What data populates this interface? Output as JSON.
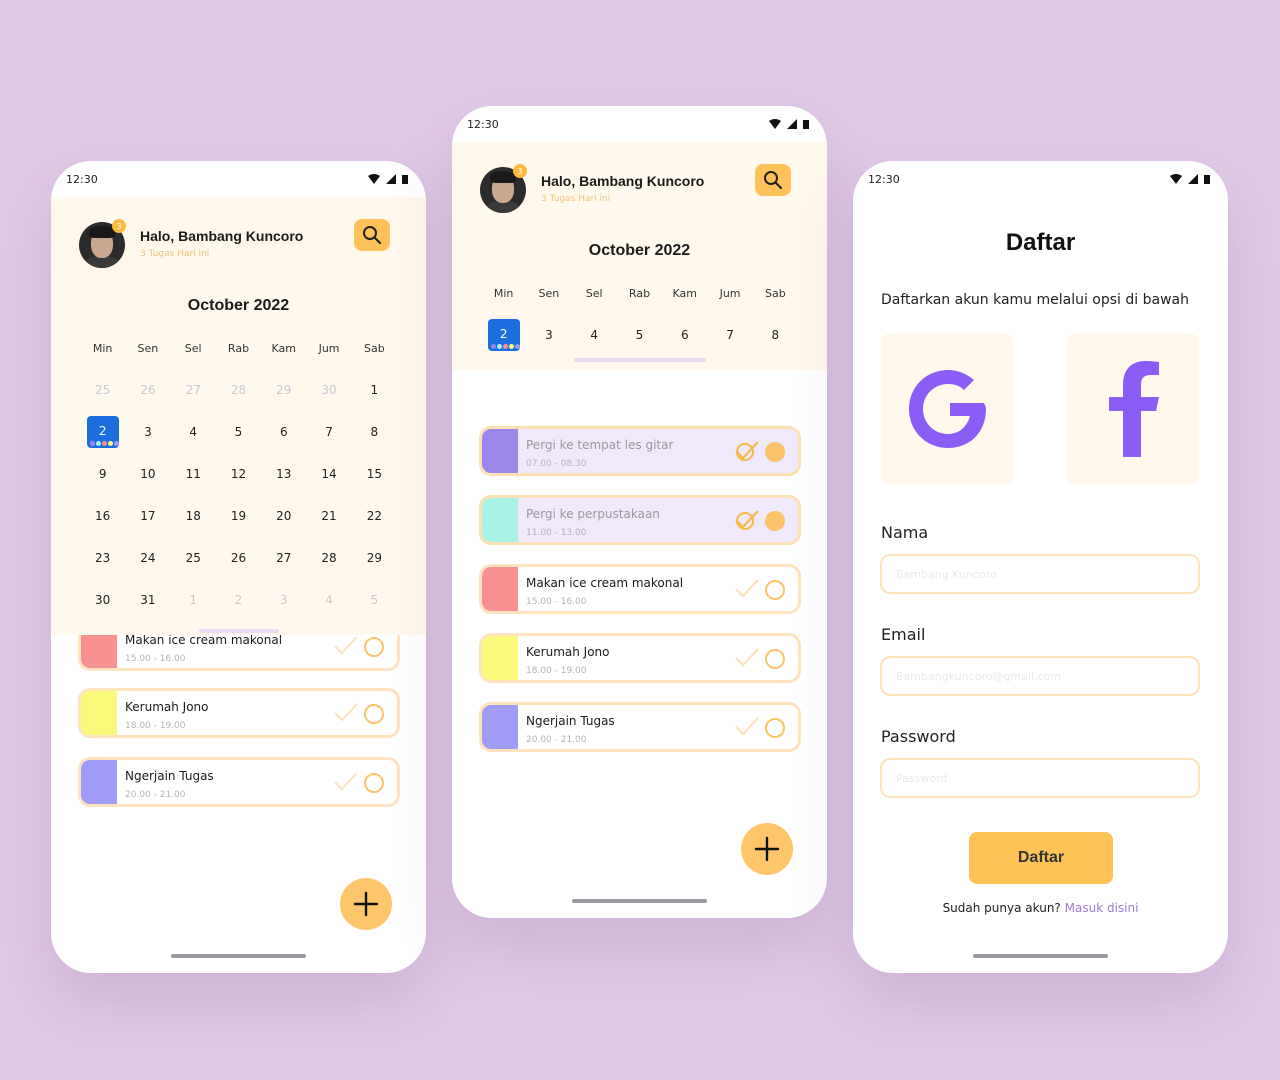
{
  "status": {
    "time": "12:30"
  },
  "user": {
    "greeting": "Halo, Bambang Kuncoro",
    "subtitle": "3 Tugas Hari ini",
    "badge": "3"
  },
  "calendar": {
    "month": "October 2022",
    "weekdays": [
      "Min",
      "Sen",
      "Sel",
      "Rab",
      "Kam",
      "Jum",
      "Sab"
    ],
    "selected_day": "2",
    "month_weeks": [
      [
        "25",
        "26",
        "27",
        "28",
        "29",
        "30",
        "1"
      ],
      [
        "2",
        "3",
        "4",
        "5",
        "6",
        "7",
        "8"
      ],
      [
        "9",
        "10",
        "11",
        "12",
        "13",
        "14",
        "15"
      ],
      [
        "16",
        "17",
        "18",
        "19",
        "20",
        "21",
        "22"
      ],
      [
        "23",
        "24",
        "25",
        "26",
        "27",
        "28",
        "29"
      ],
      [
        "30",
        "31",
        "1",
        "2",
        "3",
        "4",
        "5"
      ]
    ],
    "week_days": [
      "2",
      "3",
      "4",
      "5",
      "6",
      "7",
      "8"
    ]
  },
  "tasks": [
    {
      "title": "Pergi ke tempat les gitar",
      "time": "07.00 - 08.30",
      "color": "#9d86ea",
      "done": true
    },
    {
      "title": "Pergi ke perpustakaan",
      "time": "11.00 - 13.00",
      "color": "#a8f3e6",
      "done": true
    },
    {
      "title": "Makan ice cream makonal",
      "time": "15.00 - 16.00",
      "color": "#f79192",
      "done": false
    },
    {
      "title": "Kerumah Jono",
      "time": "18.00 - 19.00",
      "color": "#fbf97a",
      "done": false
    },
    {
      "title": "Ngerjain Tugas",
      "time": "20.00 - 21.00",
      "color": "#a19cf8",
      "done": false
    }
  ],
  "register": {
    "title": "Daftar",
    "subtitle": "Daftarkan akun kamu melalui opsi di bawah",
    "google_letter": "G",
    "facebook_letter": "f",
    "name_label": "Nama",
    "name_placeholder": "Bambang Kuncoro",
    "email_label": "Email",
    "email_placeholder": "Bambangkuncoro@gmail.com",
    "password_label": "Password",
    "password_placeholder": "Password",
    "submit_label": "Daftar",
    "login_prompt": "Sudah punya akun?",
    "login_link": "Masuk disini"
  },
  "colors": {
    "background": "#e0c9e6",
    "cream": "#fff8ec",
    "accent": "#ffc256",
    "selected": "#1d6fe0",
    "brand_purple": "#8b5cf6"
  }
}
